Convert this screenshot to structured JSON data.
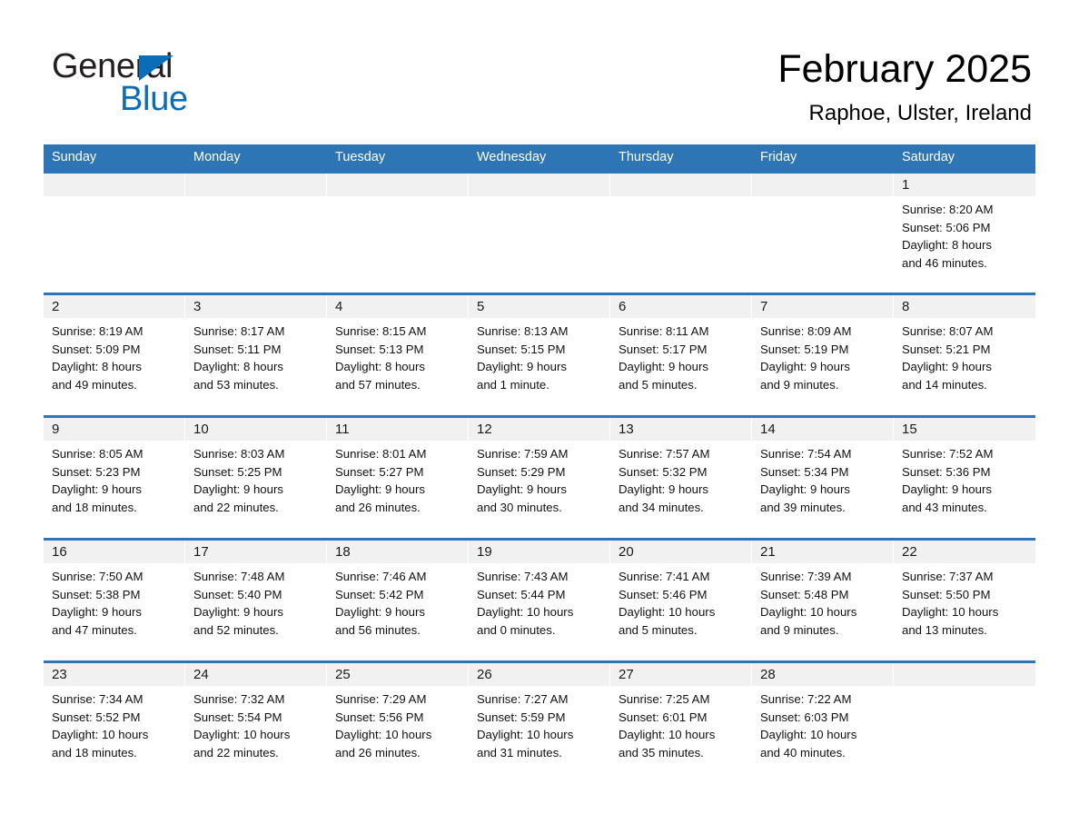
{
  "brand": {
    "name_part1": "General",
    "name_part2": "Blue",
    "accent_color": "#0b6cb7"
  },
  "header": {
    "title": "February 2025",
    "location": "Raphoe, Ulster, Ireland"
  },
  "theme": {
    "header_blue": "#2e75b6",
    "daynum_band": "#f1f1f1",
    "text": "#111111"
  },
  "weekdays": [
    "Sunday",
    "Monday",
    "Tuesday",
    "Wednesday",
    "Thursday",
    "Friday",
    "Saturday"
  ],
  "weeks": [
    [
      {
        "empty": true
      },
      {
        "empty": true
      },
      {
        "empty": true
      },
      {
        "empty": true
      },
      {
        "empty": true
      },
      {
        "empty": true
      },
      {
        "day": "1",
        "sunrise": "Sunrise: 8:20 AM",
        "sunset": "Sunset: 5:06 PM",
        "daylight1": "Daylight: 8 hours",
        "daylight2": "and 46 minutes."
      }
    ],
    [
      {
        "day": "2",
        "sunrise": "Sunrise: 8:19 AM",
        "sunset": "Sunset: 5:09 PM",
        "daylight1": "Daylight: 8 hours",
        "daylight2": "and 49 minutes."
      },
      {
        "day": "3",
        "sunrise": "Sunrise: 8:17 AM",
        "sunset": "Sunset: 5:11 PM",
        "daylight1": "Daylight: 8 hours",
        "daylight2": "and 53 minutes."
      },
      {
        "day": "4",
        "sunrise": "Sunrise: 8:15 AM",
        "sunset": "Sunset: 5:13 PM",
        "daylight1": "Daylight: 8 hours",
        "daylight2": "and 57 minutes."
      },
      {
        "day": "5",
        "sunrise": "Sunrise: 8:13 AM",
        "sunset": "Sunset: 5:15 PM",
        "daylight1": "Daylight: 9 hours",
        "daylight2": "and 1 minute."
      },
      {
        "day": "6",
        "sunrise": "Sunrise: 8:11 AM",
        "sunset": "Sunset: 5:17 PM",
        "daylight1": "Daylight: 9 hours",
        "daylight2": "and 5 minutes."
      },
      {
        "day": "7",
        "sunrise": "Sunrise: 8:09 AM",
        "sunset": "Sunset: 5:19 PM",
        "daylight1": "Daylight: 9 hours",
        "daylight2": "and 9 minutes."
      },
      {
        "day": "8",
        "sunrise": "Sunrise: 8:07 AM",
        "sunset": "Sunset: 5:21 PM",
        "daylight1": "Daylight: 9 hours",
        "daylight2": "and 14 minutes."
      }
    ],
    [
      {
        "day": "9",
        "sunrise": "Sunrise: 8:05 AM",
        "sunset": "Sunset: 5:23 PM",
        "daylight1": "Daylight: 9 hours",
        "daylight2": "and 18 minutes."
      },
      {
        "day": "10",
        "sunrise": "Sunrise: 8:03 AM",
        "sunset": "Sunset: 5:25 PM",
        "daylight1": "Daylight: 9 hours",
        "daylight2": "and 22 minutes."
      },
      {
        "day": "11",
        "sunrise": "Sunrise: 8:01 AM",
        "sunset": "Sunset: 5:27 PM",
        "daylight1": "Daylight: 9 hours",
        "daylight2": "and 26 minutes."
      },
      {
        "day": "12",
        "sunrise": "Sunrise: 7:59 AM",
        "sunset": "Sunset: 5:29 PM",
        "daylight1": "Daylight: 9 hours",
        "daylight2": "and 30 minutes."
      },
      {
        "day": "13",
        "sunrise": "Sunrise: 7:57 AM",
        "sunset": "Sunset: 5:32 PM",
        "daylight1": "Daylight: 9 hours",
        "daylight2": "and 34 minutes."
      },
      {
        "day": "14",
        "sunrise": "Sunrise: 7:54 AM",
        "sunset": "Sunset: 5:34 PM",
        "daylight1": "Daylight: 9 hours",
        "daylight2": "and 39 minutes."
      },
      {
        "day": "15",
        "sunrise": "Sunrise: 7:52 AM",
        "sunset": "Sunset: 5:36 PM",
        "daylight1": "Daylight: 9 hours",
        "daylight2": "and 43 minutes."
      }
    ],
    [
      {
        "day": "16",
        "sunrise": "Sunrise: 7:50 AM",
        "sunset": "Sunset: 5:38 PM",
        "daylight1": "Daylight: 9 hours",
        "daylight2": "and 47 minutes."
      },
      {
        "day": "17",
        "sunrise": "Sunrise: 7:48 AM",
        "sunset": "Sunset: 5:40 PM",
        "daylight1": "Daylight: 9 hours",
        "daylight2": "and 52 minutes."
      },
      {
        "day": "18",
        "sunrise": "Sunrise: 7:46 AM",
        "sunset": "Sunset: 5:42 PM",
        "daylight1": "Daylight: 9 hours",
        "daylight2": "and 56 minutes."
      },
      {
        "day": "19",
        "sunrise": "Sunrise: 7:43 AM",
        "sunset": "Sunset: 5:44 PM",
        "daylight1": "Daylight: 10 hours",
        "daylight2": "and 0 minutes."
      },
      {
        "day": "20",
        "sunrise": "Sunrise: 7:41 AM",
        "sunset": "Sunset: 5:46 PM",
        "daylight1": "Daylight: 10 hours",
        "daylight2": "and 5 minutes."
      },
      {
        "day": "21",
        "sunrise": "Sunrise: 7:39 AM",
        "sunset": "Sunset: 5:48 PM",
        "daylight1": "Daylight: 10 hours",
        "daylight2": "and 9 minutes."
      },
      {
        "day": "22",
        "sunrise": "Sunrise: 7:37 AM",
        "sunset": "Sunset: 5:50 PM",
        "daylight1": "Daylight: 10 hours",
        "daylight2": "and 13 minutes."
      }
    ],
    [
      {
        "day": "23",
        "sunrise": "Sunrise: 7:34 AM",
        "sunset": "Sunset: 5:52 PM",
        "daylight1": "Daylight: 10 hours",
        "daylight2": "and 18 minutes."
      },
      {
        "day": "24",
        "sunrise": "Sunrise: 7:32 AM",
        "sunset": "Sunset: 5:54 PM",
        "daylight1": "Daylight: 10 hours",
        "daylight2": "and 22 minutes."
      },
      {
        "day": "25",
        "sunrise": "Sunrise: 7:29 AM",
        "sunset": "Sunset: 5:56 PM",
        "daylight1": "Daylight: 10 hours",
        "daylight2": "and 26 minutes."
      },
      {
        "day": "26",
        "sunrise": "Sunrise: 7:27 AM",
        "sunset": "Sunset: 5:59 PM",
        "daylight1": "Daylight: 10 hours",
        "daylight2": "and 31 minutes."
      },
      {
        "day": "27",
        "sunrise": "Sunrise: 7:25 AM",
        "sunset": "Sunset: 6:01 PM",
        "daylight1": "Daylight: 10 hours",
        "daylight2": "and 35 minutes."
      },
      {
        "day": "28",
        "sunrise": "Sunrise: 7:22 AM",
        "sunset": "Sunset: 6:03 PM",
        "daylight1": "Daylight: 10 hours",
        "daylight2": "and 40 minutes."
      },
      {
        "empty": true
      }
    ]
  ]
}
